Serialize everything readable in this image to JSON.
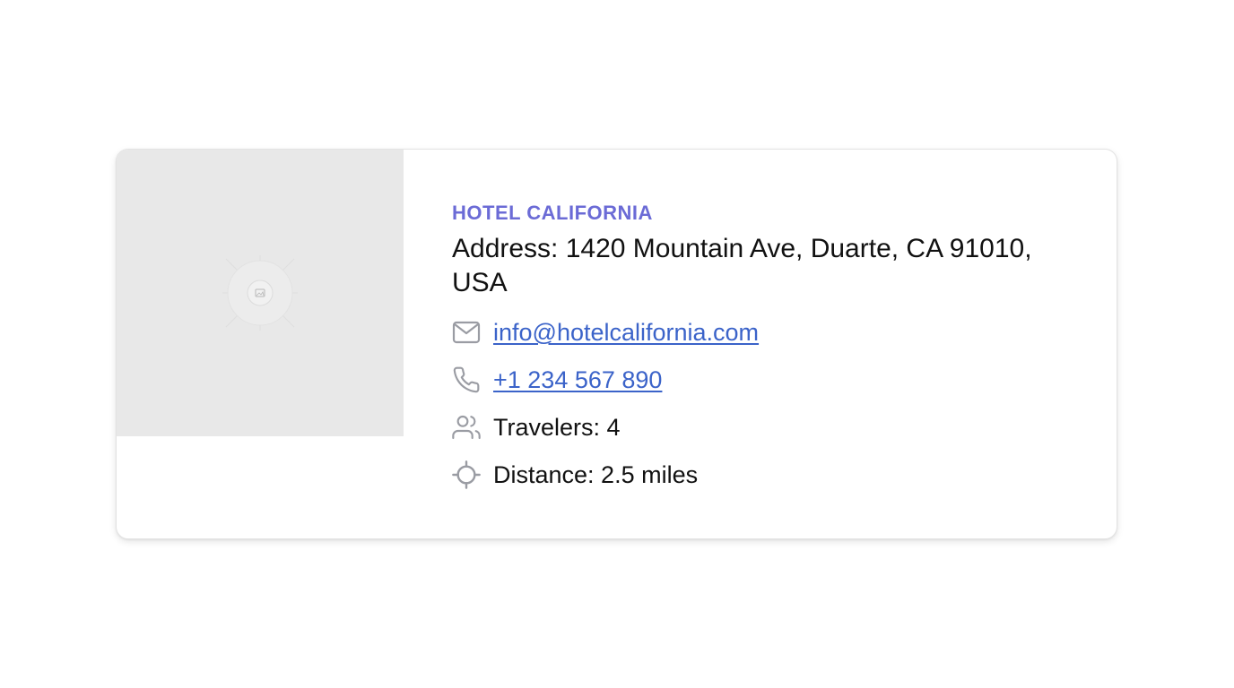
{
  "hotel": {
    "name": "HOTEL CALIFORNIA",
    "address": "Address: 1420 Mountain Ave, Duarte, CA 91010, USA",
    "email": "info@hotelcalifornia.com",
    "phone": "+1 234 567 890",
    "travelers": "Travelers: 4",
    "distance": "Distance: 2.5 miles"
  },
  "icons": {
    "image": "image-placeholder-icon",
    "email": "mail-icon",
    "phone": "phone-icon",
    "travelers": "users-icon",
    "distance": "crosshair-icon"
  },
  "colors": {
    "accent": "#6b6bd6",
    "link": "#3b63c9",
    "icon": "#9a9ca3",
    "placeholder_bg": "#e8e8e8"
  }
}
